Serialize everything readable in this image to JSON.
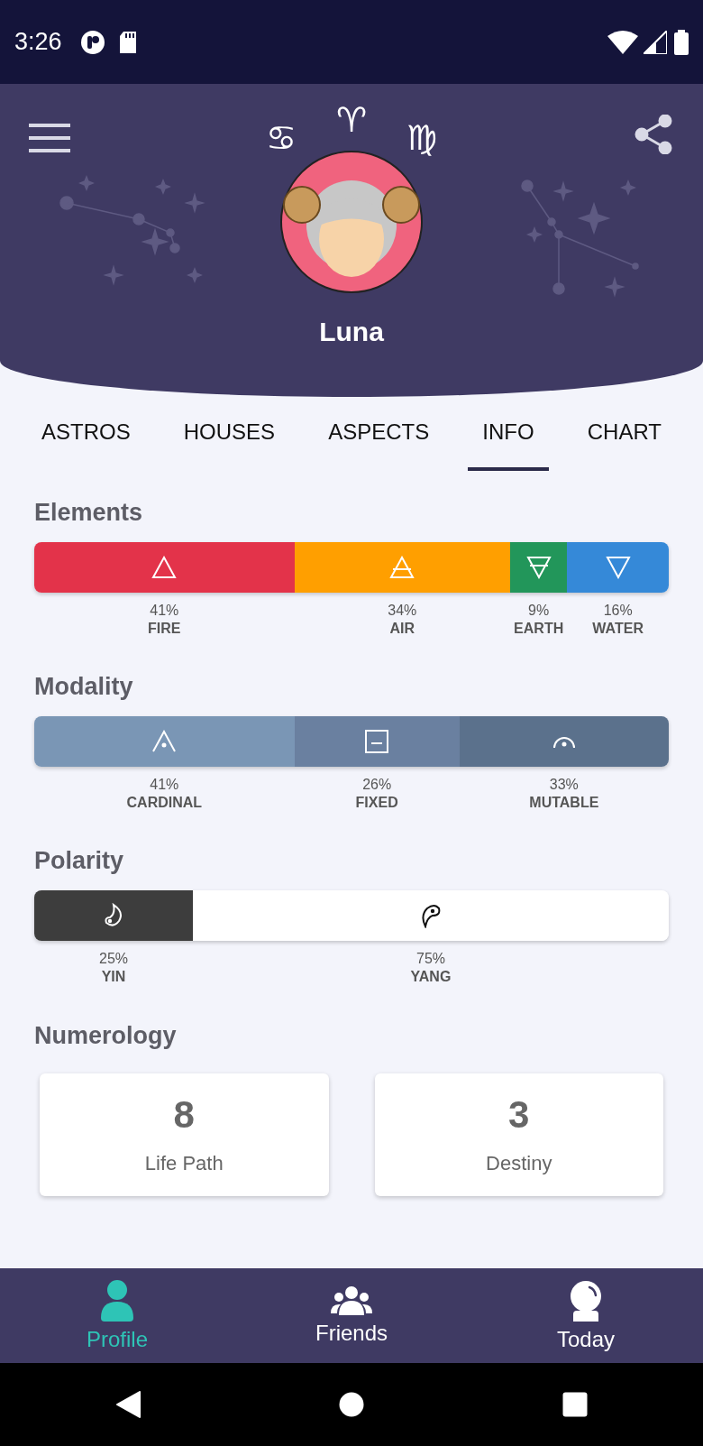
{
  "status_bar": {
    "time": "3:26"
  },
  "header": {
    "zodiac_signs": [
      "♋",
      "♈",
      "♍"
    ],
    "name": "Luna"
  },
  "tabs": [
    {
      "label": "ASTROS",
      "selected": false
    },
    {
      "label": "HOUSES",
      "selected": false
    },
    {
      "label": "ASPECTS",
      "selected": false
    },
    {
      "label": "INFO",
      "selected": true
    },
    {
      "label": "CHART",
      "selected": false
    }
  ],
  "sections": [
    {
      "title": "Elements",
      "segments": [
        {
          "kind": "fire",
          "percent": "41%",
          "label": "FIRE",
          "color": "#e3334a"
        },
        {
          "kind": "air",
          "percent": "34%",
          "label": "AIR",
          "color": "#ff9f00"
        },
        {
          "kind": "earth",
          "percent": "9%",
          "label": "EARTH",
          "color": "#22965a"
        },
        {
          "kind": "water",
          "percent": "16%",
          "label": "WATER",
          "color": "#3589d8"
        }
      ]
    },
    {
      "title": "Modality",
      "segments": [
        {
          "kind": "cardinal",
          "percent": "41%",
          "label": "CARDINAL",
          "color": "#7a96b5"
        },
        {
          "kind": "fixed",
          "percent": "26%",
          "label": "FIXED",
          "color": "#6a80a0"
        },
        {
          "kind": "mutable",
          "percent": "33%",
          "label": "MUTABLE",
          "color": "#5b718c"
        }
      ]
    },
    {
      "title": "Polarity",
      "segments": [
        {
          "kind": "yin",
          "percent": "25%",
          "label": "YIN",
          "color": "#3d3d3d"
        },
        {
          "kind": "yang",
          "percent": "75%",
          "label": "YANG",
          "color": "#ffffff"
        }
      ]
    }
  ],
  "numerology": {
    "title": "Numerology",
    "cards": [
      {
        "number": "8",
        "label": "Life Path"
      },
      {
        "number": "3",
        "label": "Destiny"
      }
    ]
  },
  "bottom_nav": [
    {
      "kind": "profile",
      "label": "Profile",
      "selected": true
    },
    {
      "kind": "friends",
      "label": "Friends",
      "selected": false
    },
    {
      "kind": "today",
      "label": "Today",
      "selected": false
    }
  ]
}
